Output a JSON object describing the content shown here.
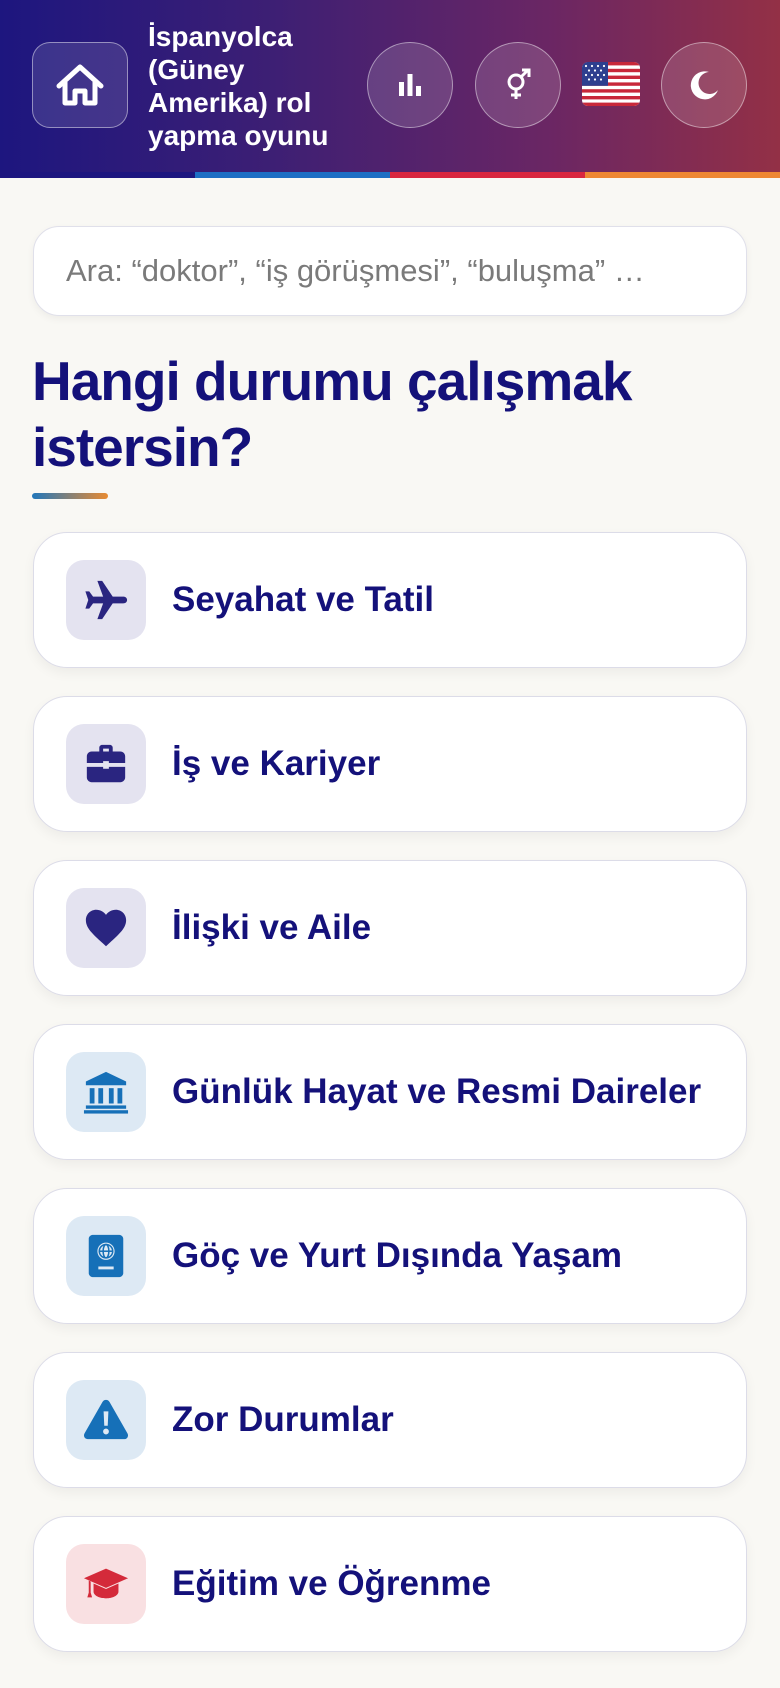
{
  "header": {
    "title": "İspanyolca (Güney Amerika) rol yapma oyunu",
    "home_icon": "home-icon",
    "stats_icon": "bar-chart-icon",
    "gender_icon": "gender-icon",
    "flag_icon": "us-flag-icon",
    "theme_icon": "moon-icon",
    "stripe_colors": [
      "#1d167f",
      "#1e6fc4",
      "#d9263f",
      "#ee8733"
    ]
  },
  "search": {
    "placeholder": "Ara: “doktor”, “iş görüşmesi”, “buluşma” …"
  },
  "main": {
    "heading": "Hangi durumu çalışmak istersin?",
    "categories": [
      {
        "label": "Seyahat ve Tatil",
        "icon": "airplane-icon",
        "color": "#2a2580",
        "bg": "#e4e3f0"
      },
      {
        "label": "İş ve Kariyer",
        "icon": "briefcase-icon",
        "color": "#2a2580",
        "bg": "#e4e3f0"
      },
      {
        "label": "İlişki ve Aile",
        "icon": "heart-icon",
        "color": "#2a2580",
        "bg": "#e4e3f0"
      },
      {
        "label": "Günlük Hayat ve Resmi Daireler",
        "icon": "bank-icon",
        "color": "#1670b8",
        "bg": "#dde9f4"
      },
      {
        "label": "Göç ve Yurt Dışında Yaşam",
        "icon": "passport-icon",
        "color": "#1670b8",
        "bg": "#dde9f4"
      },
      {
        "label": "Zor Durumlar",
        "icon": "warning-icon",
        "color": "#1670b8",
        "bg": "#dde9f4"
      },
      {
        "label": "Eğitim ve Öğrenme",
        "icon": "graduation-cap-icon",
        "color": "#d42a3a",
        "bg": "#f9e0e2"
      }
    ]
  }
}
